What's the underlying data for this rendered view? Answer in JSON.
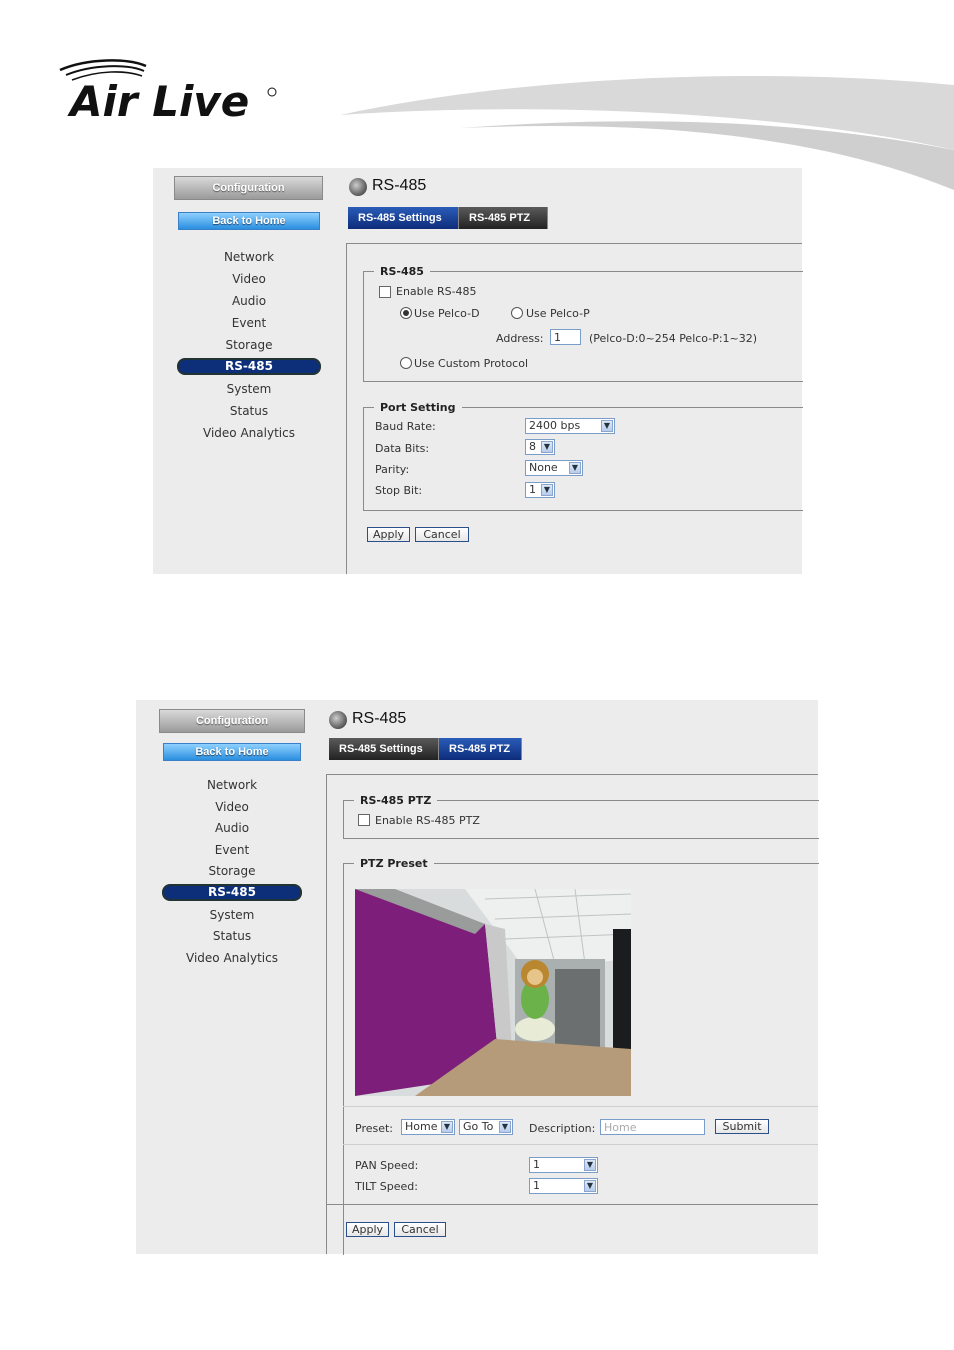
{
  "brand": {
    "logo_text": "Air Live",
    "colors": {
      "accent": "#0d2f7a",
      "tab_active": "#1d4aa0",
      "panel_bg": "#ececec"
    }
  },
  "panel1": {
    "sidebar": {
      "config_label": "Configuration",
      "home_label": "Back to Home",
      "items": [
        "Network",
        "Video",
        "Audio",
        "Event",
        "Storage",
        "RS-485",
        "System",
        "Status",
        "Video Analytics"
      ],
      "active": "RS-485"
    },
    "title": "RS-485",
    "tabs": [
      {
        "label": "RS-485 Settings",
        "active": true
      },
      {
        "label": "RS-485 PTZ",
        "active": false
      }
    ],
    "rs485": {
      "legend": "RS-485",
      "enable_label": "Enable RS-485",
      "enable_checked": false,
      "pelco_d_label": "Use Pelco-D",
      "pelco_p_label": "Use Pelco-P",
      "address_label": "Address:",
      "address_value": "1",
      "address_hint": "(Pelco-D:0~254 Pelco-P:1~32)",
      "custom_label": "Use Custom Protocol"
    },
    "port": {
      "legend": "Port Setting",
      "baud_label": "Baud Rate:",
      "baud_value": "2400 bps",
      "data_label": "Data Bits:",
      "data_value": "8",
      "parity_label": "Parity:",
      "parity_value": "None",
      "stop_label": "Stop Bit:",
      "stop_value": "1"
    },
    "apply_label": "Apply",
    "cancel_label": "Cancel"
  },
  "panel2": {
    "sidebar": {
      "config_label": "Configuration",
      "home_label": "Back to Home",
      "items": [
        "Network",
        "Video",
        "Audio",
        "Event",
        "Storage",
        "RS-485",
        "System",
        "Status",
        "Video Analytics"
      ],
      "active": "RS-485"
    },
    "title": "RS-485",
    "tabs": [
      {
        "label": "RS-485 Settings",
        "active": false
      },
      {
        "label": "RS-485 PTZ",
        "active": true
      }
    ],
    "ptz": {
      "legend": "RS-485 PTZ",
      "enable_label": "Enable RS-485 PTZ",
      "enable_checked": false
    },
    "preset": {
      "legend": "PTZ Preset",
      "preset_label": "Preset:",
      "preset_value": "Home",
      "goto_value": "Go To",
      "desc_label": "Description:",
      "desc_placeholder": "Home",
      "submit_label": "Submit",
      "pan_label": "PAN Speed:",
      "pan_value": "1",
      "tilt_label": "TILT Speed:",
      "tilt_value": "1"
    },
    "apply_label": "Apply",
    "cancel_label": "Cancel"
  }
}
